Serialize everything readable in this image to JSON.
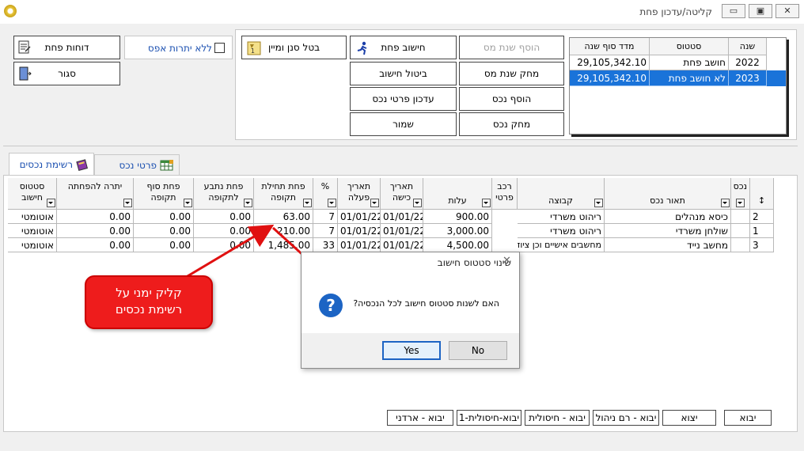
{
  "window": {
    "title": "קליטה/עדכון פחת",
    "minimize_label": "▭",
    "restore_label": "▣",
    "close_label": "✕"
  },
  "toolbar": {
    "reports_label": "דוחות פחת",
    "close_label": "סגור",
    "zero_balance_label": "ללא יתרות אפס",
    "cancel_filter_label": "בטל סנן ומיין",
    "calc_depreciation_label": "חישוב פחת",
    "add_tax_year_label": "הוסף שנת מס",
    "cancel_calc_label": "ביטול חישוב",
    "delete_tax_year_label": "מחק שנת מס",
    "update_asset_details_label": "עדכון פרטי נכס",
    "add_asset_label": "הוסף נכס",
    "save_label": "שמור",
    "delete_asset_label": "מחק נכס"
  },
  "years_table": {
    "headers": [
      "שנה",
      "סטטוס",
      "מדד סוף שנה"
    ],
    "rows": [
      {
        "year": "2022",
        "status": "חושב פחת",
        "index": "29,105,342.10"
      },
      {
        "year": "2023",
        "status": "לא חושב פחת",
        "index": "29,105,342.10"
      }
    ],
    "selected_row": 1
  },
  "tabs": [
    {
      "label": "רשימת נכסים",
      "active": true
    },
    {
      "label": "פרטי נכס",
      "active": false
    }
  ],
  "assets_table": {
    "headers": {
      "asset_no": "נכס",
      "description": "תאור נכס",
      "group": "קבוצה",
      "component": "רכב פרטי",
      "cost": "עלות",
      "purchase_date": "תאריך כישה",
      "operation_date": "תאריך פעלה",
      "percent": "%",
      "opening_dep": "פחת תחילת תקופה",
      "period_dep": "פחת נתבע לתקופה",
      "closing_dep": "פחת סוף תקופה",
      "balance": "יתרה להפחתה",
      "status": "סטטוס חישוב"
    },
    "rows": [
      {
        "asset_no": "2",
        "description": "כיסא מנהלים",
        "group": "ריהוט משרדי",
        "cost": "900.00",
        "purchase_date": "01/01/22",
        "operation_date": "01/01/22",
        "percent": "7",
        "opening_dep": "63.00",
        "period_dep": "0.00",
        "closing_dep": "0.00",
        "balance": "0.00",
        "status": "אוטומטי"
      },
      {
        "asset_no": "1",
        "description": "שולחן משרדי",
        "group": "ריהוט משרדי",
        "cost": "3,000.00",
        "purchase_date": "01/01/22",
        "operation_date": "01/01/22",
        "percent": "7",
        "opening_dep": "210.00",
        "period_dep": "0.00",
        "closing_dep": "0.00",
        "balance": "0.00",
        "status": "אוטומטי"
      },
      {
        "asset_no": "3",
        "description": "מחשב נייד",
        "group": "מחשבים אישיים וכן ציוד",
        "cost": "4,500.00",
        "purchase_date": "01/01/22",
        "operation_date": "01/01/22",
        "percent": "33",
        "opening_dep": "1,485.00",
        "period_dep": "0.00",
        "closing_dep": "0.00",
        "balance": "0.00",
        "status": "אוטומטי"
      }
    ]
  },
  "dialog": {
    "title": "שינוי סטטוס חישוב",
    "message": "האם לשנות סטטוס חישוב לכל הנכסיה?",
    "yes_label": "Yes",
    "no_label": "No",
    "close_glyph": "✕",
    "question_glyph": "?"
  },
  "callout": {
    "line1": "קליק ימני על",
    "line2": "רשימת נכסים"
  },
  "bottom_buttons": [
    {
      "label": "יבוא"
    },
    {
      "label": "יצוא"
    },
    {
      "label": "יבוא - רם ניהול"
    },
    {
      "label": "יבוא - חיסולית"
    },
    {
      "label": "יבוא-חיסולית-1"
    },
    {
      "label": "יבוא - ארדני"
    }
  ],
  "colors": {
    "selection": "#1a73d9",
    "callout": "#ee1c1c",
    "arrow": "#e01010",
    "tab_text": "#1a4fb0"
  }
}
